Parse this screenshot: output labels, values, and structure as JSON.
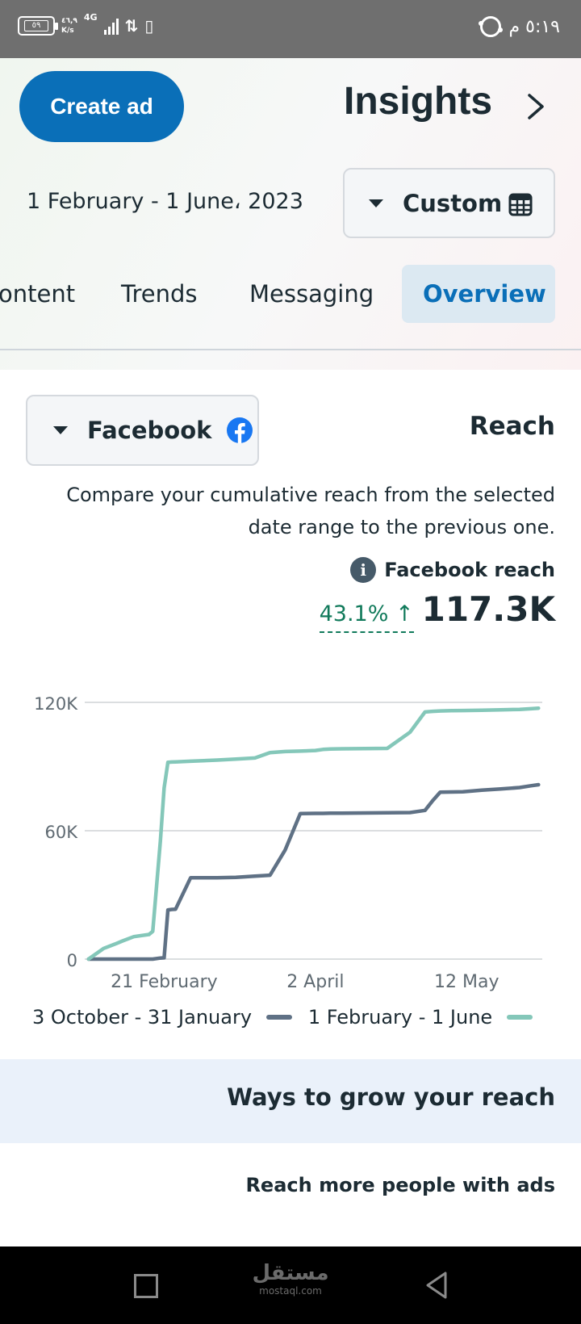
{
  "status_bar": {
    "battery": "٥٩",
    "net_speed": "٤٦,٩",
    "net_unit": "K/s",
    "net_type": "4G",
    "time": "٥:١٩ م"
  },
  "header": {
    "create_ad_label": "Create ad",
    "title": "Insights",
    "date_range": "1 February - 1 June، 2023",
    "custom_label": "Custom"
  },
  "tabs": [
    {
      "label": "ontent"
    },
    {
      "label": "Trends"
    },
    {
      "label": "Messaging"
    },
    {
      "label": "Overview",
      "active": true
    }
  ],
  "card": {
    "platform": "Facebook",
    "title": "Reach",
    "description": "Compare your cumulative reach from the selected date range to the previous one.",
    "metric_label": "Facebook reach",
    "metric_change": "43.1% ↑",
    "metric_value": "117.3K"
  },
  "chart_data": {
    "type": "line",
    "x_ticks": [
      "21 February",
      "2 April",
      "12 May"
    ],
    "x": [
      1,
      5,
      8,
      10,
      13,
      17,
      18,
      20,
      21,
      22,
      23,
      24,
      28,
      35,
      40,
      45,
      49,
      53,
      57,
      61,
      63,
      65,
      68,
      74,
      80,
      86,
      90,
      92,
      94,
      97,
      100,
      105,
      110,
      115,
      118,
      120
    ],
    "y_ticks": [
      0,
      60000,
      120000
    ],
    "y_tick_labels": [
      "0",
      "60K",
      "120K"
    ],
    "ylim": [
      0,
      120000
    ],
    "xlim": [
      0,
      121
    ],
    "grid": true,
    "series": [
      {
        "name": "3 October - 31 January",
        "color": "#5f7185",
        "values": [
          0,
          0,
          0,
          0,
          0,
          0,
          0,
          500,
          600,
          23000,
          23200,
          23300,
          38000,
          38000,
          38200,
          38800,
          39200,
          51000,
          68000,
          68100,
          68100,
          68200,
          68200,
          68300,
          68400,
          68500,
          69500,
          74000,
          78000,
          78100,
          78200,
          79000,
          79500,
          80200,
          81000,
          81500
        ]
      },
      {
        "name": "1 February - 1 June",
        "color": "#84c7b9",
        "values": [
          0,
          5000,
          7000,
          8500,
          10500,
          11500,
          13000,
          55000,
          80000,
          92000,
          92100,
          92200,
          92500,
          93000,
          93500,
          94000,
          96500,
          97000,
          97200,
          97500,
          98000,
          98200,
          98300,
          98400,
          98500,
          106000,
          115500,
          115800,
          116000,
          116100,
          116200,
          116300,
          116500,
          116700,
          117000,
          117300
        ]
      }
    ]
  },
  "legend": [
    {
      "label": "3 October - 31 January",
      "color": "#5f7185"
    },
    {
      "label": "1 February - 1 June",
      "color": "#84c7b9"
    }
  ],
  "grow": {
    "title": "Ways to grow your reach",
    "subtitle": "Reach more people with ads"
  },
  "nav": {
    "watermark": "مستقل",
    "watermark_sub": "mostaql.com"
  }
}
